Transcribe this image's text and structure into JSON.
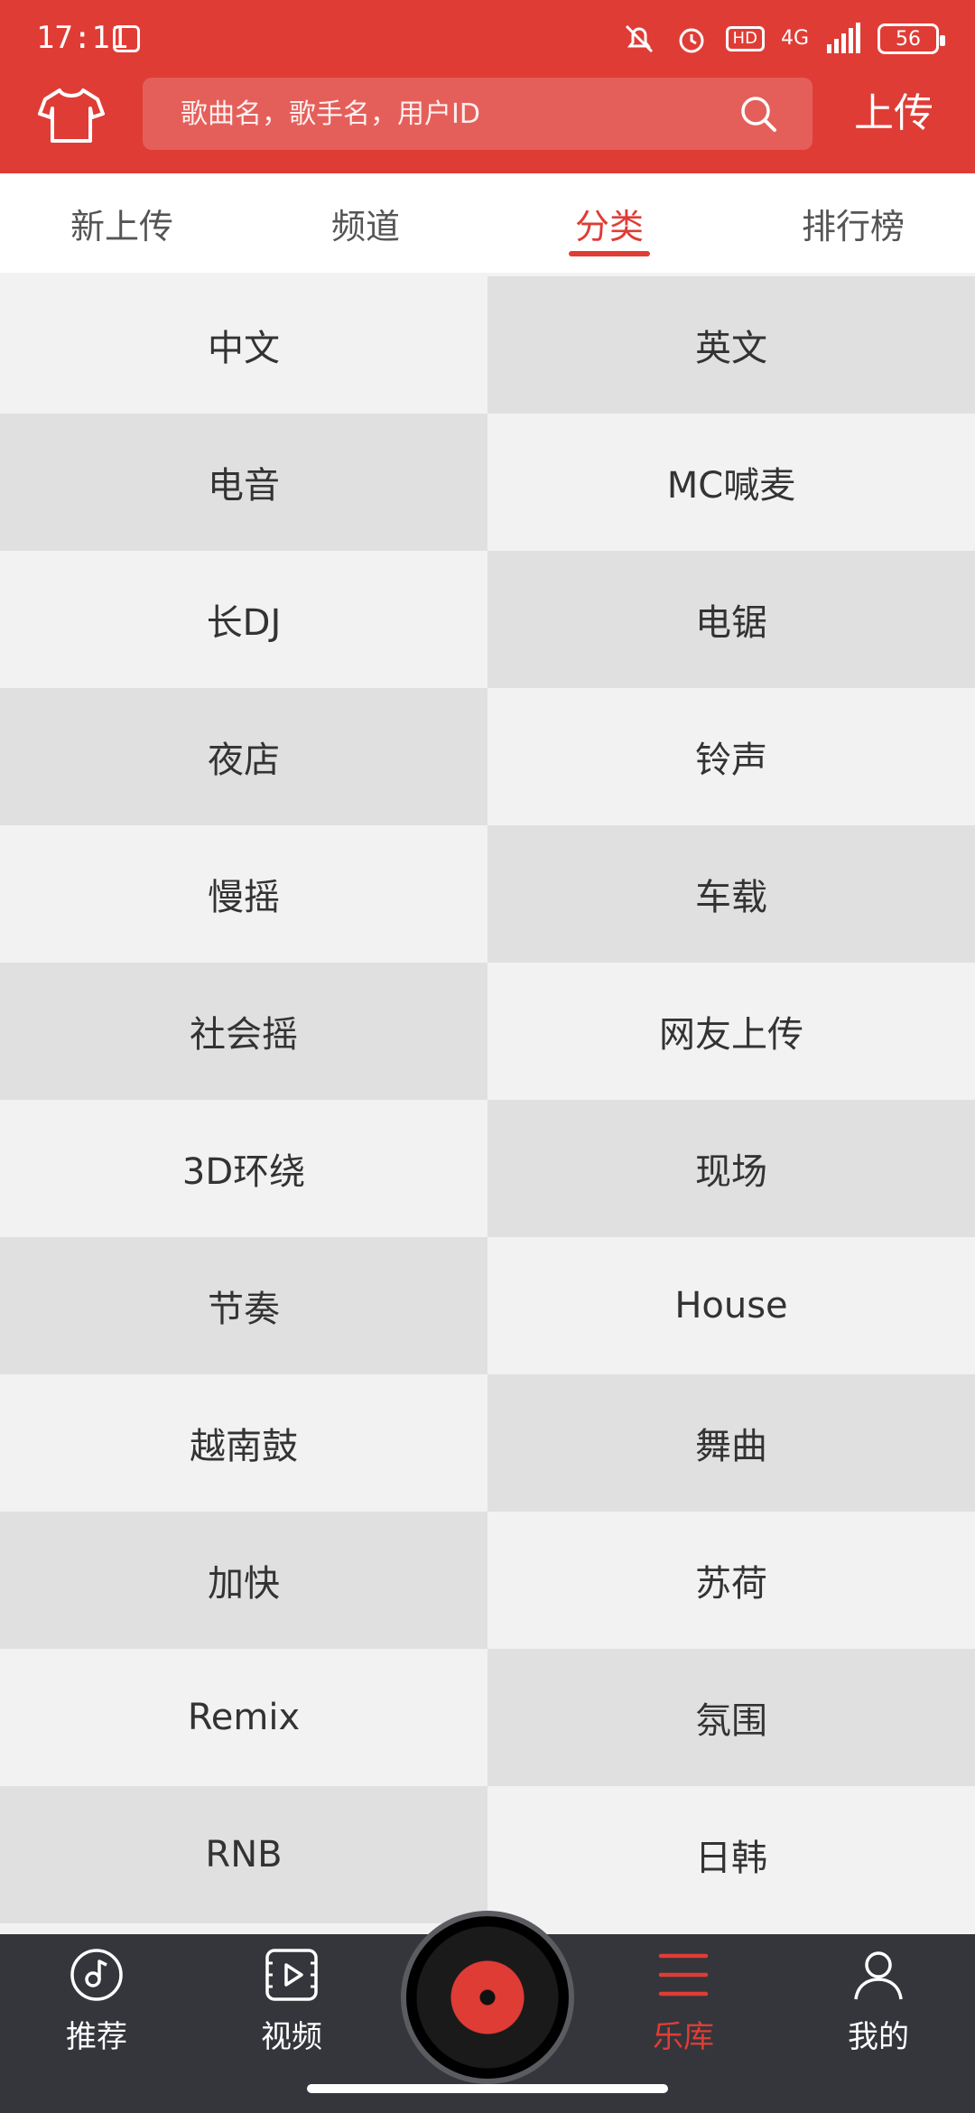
{
  "status": {
    "time": "17:11",
    "hd": "HD",
    "network": "4G",
    "battery": "56"
  },
  "header": {
    "search_placeholder": "歌曲名，歌手名，用户ID",
    "upload_label": "上传"
  },
  "tabs": [
    {
      "label": "新上传",
      "active": false
    },
    {
      "label": "频道",
      "active": false
    },
    {
      "label": "分类",
      "active": true
    },
    {
      "label": "排行榜",
      "active": false
    }
  ],
  "categories": [
    "中文",
    "英文",
    "电音",
    "MC喊麦",
    "长DJ",
    "电锯",
    "夜店",
    "铃声",
    "慢摇",
    "车载",
    "社会摇",
    "网友上传",
    "3D环绕",
    "现场",
    "节奏",
    "House",
    "越南鼓",
    "舞曲",
    "加快",
    "苏荷",
    "Remix",
    "氛围",
    "RNB",
    "日韩"
  ],
  "nav": [
    {
      "label": "推荐",
      "active": false,
      "icon": "music-note-icon"
    },
    {
      "label": "视频",
      "active": false,
      "icon": "video-icon"
    },
    {
      "label": "乐库",
      "active": true,
      "icon": "menu-icon"
    },
    {
      "label": "我的",
      "active": false,
      "icon": "user-icon"
    }
  ],
  "colors": {
    "accent": "#e03c36",
    "nav_bg": "#34363b",
    "cell_light": "#f2f2f2",
    "cell_dark": "#e0e0e0"
  }
}
